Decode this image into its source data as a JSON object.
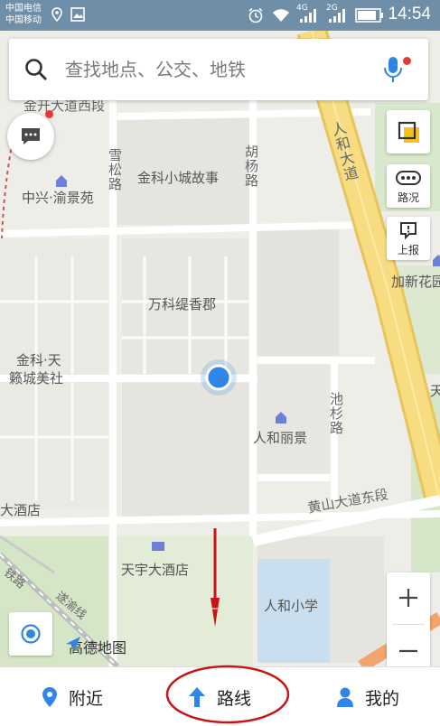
{
  "status_bar": {
    "carrier_1": "中国电信",
    "carrier_2": "中国移动",
    "signal_1": "4G",
    "signal_2": "2G",
    "time": "14:54"
  },
  "search": {
    "placeholder": "查找地点、公交、地铁"
  },
  "map_labels": {
    "road_top": "金开大道西段",
    "poi_zhongxing": "中兴·渝景苑",
    "road_xuesong": "雪松路",
    "poi_jinke_town": "金科小城故事",
    "road_huyang": "胡杨路",
    "road_renhe": "人和大道",
    "poi_jiaxin": "加新花园",
    "poi_wanke": "万科缇香郡",
    "poi_jinke_tian_1": "金科·天",
    "poi_jinke_tian_2": "籁城美社",
    "road_chishan": "池杉路",
    "poi_renhe_lijing": "人和丽景",
    "road_huangshan": "黄山大道东段",
    "poi_hotel_left": "大酒店",
    "poi_tianyu_hotel": "天宇大酒店",
    "poi_renhe_school": "人和小学",
    "rail_1": "铁路",
    "rail_2": "遂渝线",
    "poi_tian_edge": "天",
    "logo": "高德地图"
  },
  "tools": {
    "traffic": "路况",
    "report": "上报"
  },
  "bottom_nav": {
    "nearby": "附近",
    "route": "路线",
    "mine": "我的"
  },
  "colors": {
    "accent_blue": "#2f86e8",
    "mic_blue": "#2f86e8",
    "red_dot": "#e53935",
    "annotation_red": "#c81414",
    "main_road": "#f6d77a",
    "status_bar": "#6f8fa8"
  }
}
